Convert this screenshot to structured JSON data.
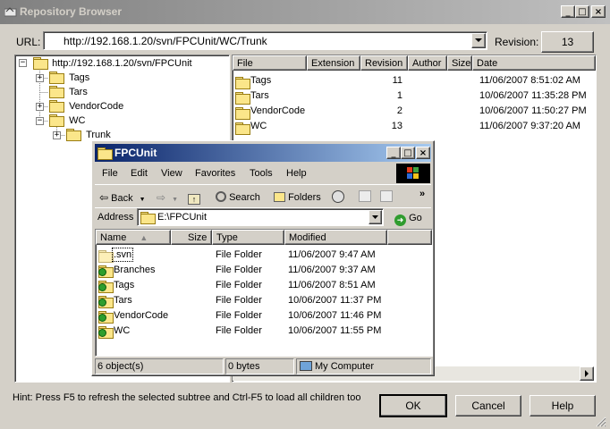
{
  "window": {
    "title": "Repository Browser"
  },
  "url_bar": {
    "label": "URL:",
    "value": "http://192.168.1.20/svn/FPCUnit/WC/Trunk",
    "revision_label": "Revision:",
    "revision_value": "13"
  },
  "tree": {
    "root": "http://192.168.1.20/svn/FPCUnit",
    "items": [
      "Tags",
      "Tars",
      "VendorCode",
      "WC",
      "Trunk"
    ]
  },
  "file_list": {
    "columns": [
      "File",
      "Extension",
      "Revision",
      "Author",
      "Size",
      "Date"
    ],
    "rows": [
      {
        "file": "Tags",
        "extension": "",
        "revision": "11",
        "author": "",
        "size": "",
        "date": "11/06/2007 8:51:02 AM"
      },
      {
        "file": "Tars",
        "extension": "",
        "revision": "1",
        "author": "",
        "size": "",
        "date": "10/06/2007 11:35:28 PM"
      },
      {
        "file": "VendorCode",
        "extension": "",
        "revision": "2",
        "author": "",
        "size": "",
        "date": "10/06/2007 11:50:27 PM"
      },
      {
        "file": "WC",
        "extension": "",
        "revision": "13",
        "author": "",
        "size": "",
        "date": "11/06/2007 9:37:20 AM"
      }
    ]
  },
  "hint": "Hint: Press F5 to refresh the selected subtree and Ctrl-F5 to load all children too",
  "buttons": {
    "ok": "OK",
    "cancel": "Cancel",
    "help": "Help"
  },
  "explorer": {
    "title": "FPCUnit",
    "menu": [
      "File",
      "Edit",
      "View",
      "Favorites",
      "Tools",
      "Help"
    ],
    "toolbar": {
      "back": "Back",
      "search": "Search",
      "folders": "Folders",
      "more": "»"
    },
    "address_label": "Address",
    "address_value": "E:\\FPCUnit",
    "go_label": "Go",
    "columns": [
      "Name",
      "Size",
      "Type",
      "Modified"
    ],
    "files": [
      {
        "name": ".svn",
        "size": "",
        "type": "File Folder",
        "modified": "11/06/2007 9:47 AM",
        "badge": false
      },
      {
        "name": "Branches",
        "size": "",
        "type": "File Folder",
        "modified": "11/06/2007 9:37 AM",
        "badge": true
      },
      {
        "name": "Tags",
        "size": "",
        "type": "File Folder",
        "modified": "11/06/2007 8:51 AM",
        "badge": true
      },
      {
        "name": "Tars",
        "size": "",
        "type": "File Folder",
        "modified": "10/06/2007 11:37 PM",
        "badge": true
      },
      {
        "name": "VendorCode",
        "size": "",
        "type": "File Folder",
        "modified": "10/06/2007 11:46 PM",
        "badge": true
      },
      {
        "name": "WC",
        "size": "",
        "type": "File Folder",
        "modified": "10/06/2007 11:55 PM",
        "badge": true
      }
    ],
    "status": {
      "objects": "6 object(s)",
      "bytes": "0 bytes",
      "location": "My Computer"
    }
  }
}
